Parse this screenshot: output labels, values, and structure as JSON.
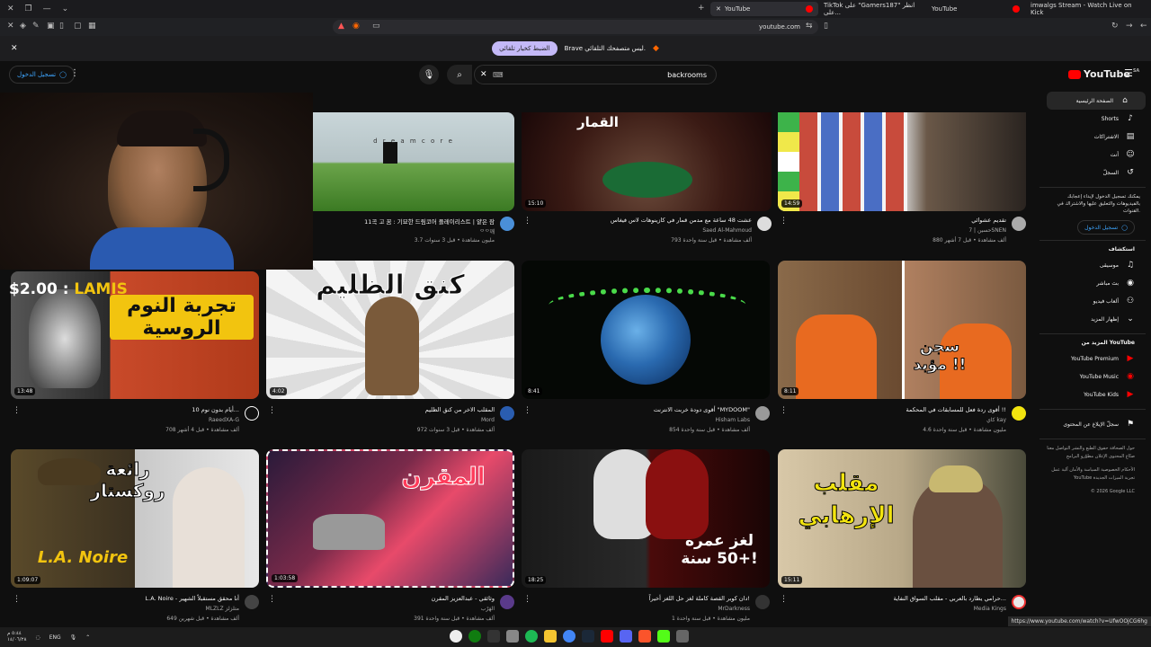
{
  "browser": {
    "tabs": [
      {
        "label": "YouTube"
      },
      {
        "label": "TikTok على \"Gamers187\" انظر على..."
      },
      {
        "label": "YouTube"
      },
      {
        "label": "imwalgs Stream - Watch Live on Kick"
      }
    ],
    "url": "youtube.com",
    "infobar_text": "Brave ليس متصفحك التلقائي.",
    "infobar_button": "الضبط كخيار تلقائي"
  },
  "youtube": {
    "search_value": "backrooms",
    "signin_label": "تسجيل الدخول",
    "logo_text": "YouTube",
    "logo_region": "SA"
  },
  "sidebar": {
    "items": [
      {
        "label": "الصفحة الرئيسية",
        "icon": "home-icon"
      },
      {
        "label": "Shorts",
        "icon": "shorts-icon"
      },
      {
        "label": "الاشتراكات",
        "icon": "subscriptions-icon"
      },
      {
        "label": "أنت",
        "icon": "you-icon"
      },
      {
        "label": "السجلّ",
        "icon": "history-icon"
      }
    ],
    "note": "يمكنك تسجيل الدخول لإبداء إعجابك بالفيديوهات والتعليق عليها والاشتراك في القنوات.",
    "signin_label": "تسجيل الدخول",
    "explore_heading": "استكشاف",
    "explore": [
      {
        "label": "موسيقى",
        "icon": "music-icon"
      },
      {
        "label": "بث مباشر",
        "icon": "live-icon"
      },
      {
        "label": "ألعاب فيديو",
        "icon": "gaming-icon"
      },
      {
        "label": "إظهار المزيد",
        "icon": "chevron-down-icon"
      }
    ],
    "more_heading": "المزيد من YouTube",
    "more": [
      {
        "label": "YouTube Premium"
      },
      {
        "label": "YouTube Music"
      },
      {
        "label": "YouTube Kids"
      }
    ],
    "report": "سجلّ الإبلاغ عن المحتوى",
    "footer1": "حول  الصحافة  حقوق الطبع والنشر  التواصل معنا  صنّاع المحتوى  الإعلان  مطوّرو البرامج",
    "footer2": "الأحكام  الخصوصية  السياسة والأمان  آلية عمل YouTube  تجربة الميزات الجديدة",
    "copyright": "© 2026 Google LLC"
  },
  "stream": {
    "donation_amount": "$2.00 : ",
    "donation_name": "LAMIS"
  },
  "videos": [
    {
      "title": "11곡 고 꿈 : 기묘한 드림코어 플레이리스트 | 얕은 잠",
      "channel": "ᄋᄋ깨",
      "views": "3.7 مليون مشاهدة • قبل 3 سنوات",
      "duration": "",
      "thumb_text": "d r e a m c o r e"
    },
    {
      "title": "عشت 48 ساعة مع مدمن قمار في كازينوهات لاس فيغاس",
      "channel": "Saed Al-Mahmoud",
      "views": "793 ألف مشاهدة • قبل سنة واحدة",
      "duration": "15:10",
      "thumb_text": "القمار"
    },
    {
      "title": "تقديم عشوائي",
      "channel": "حسين | 7SNEN",
      "views": "880 ألف مشاهدة • قبل 7 أشهر",
      "duration": "14:59",
      "thumb_text": ""
    },
    {
      "title": "10 أيام بدون نوم...",
      "channel": "RaeedXA-G",
      "views": "708 ألف مشاهدة • قبل 4 أشهر",
      "duration": "13:48",
      "thumb_text": "تجربة النوم الروسية"
    },
    {
      "title": "المقلب الاخر من كنق الظليم",
      "channel": "Mord",
      "views": "972 ألف مشاهدة • قبل 3 سنوات",
      "duration": "4:02",
      "thumb_text": "كنق الظليم"
    },
    {
      "title": "أقوى دودة خربت الانترنت \"MYDOOM\"",
      "channel": "Hisham Labs",
      "views": "854 ألف مشاهدة • قبل سنة واحدة",
      "duration": "8:41",
      "thumb_text": ""
    },
    {
      "title": "أقوى ردة فعل للمسابقات في المحكمة !!",
      "channel": "كاي kay",
      "views": "4.6 مليون مشاهدة • قبل سنة واحدة",
      "duration": "8:11",
      "thumb_text": "سجن مؤبد !!"
    },
    {
      "title": "L.A. Noire - أنا محقق مستقبلاً الشهير",
      "channel": "MLZLZ متلزلز",
      "views": "649 ألف مشاهدة • قبل شهرين",
      "duration": "1:09:07",
      "thumb_text": "رائعة روكستار"
    },
    {
      "title": "وثائقي - عبدالعزيز المقرن",
      "channel": "الهَرْب",
      "views": "391 ألف مشاهدة • قبل سنة واحدة",
      "duration": "1:03:58",
      "thumb_text": "المقرن"
    },
    {
      "title": "دان كوبر القصة كاملة لغز حل اللغز أخيراً!",
      "channel": "MrDarkness",
      "views": "1 مليون مشاهدة • قبل سنة واحدة",
      "duration": "18:25",
      "thumb_text": "لغز عمره +50 سنة!"
    },
    {
      "title": "حرامي يطارد بالعربي - مقلب السواق النفاية...",
      "channel": "Media Kings",
      "views": "",
      "duration": "15:11",
      "thumb_text": "مقلب الإرهابي"
    }
  ],
  "taskbar": {
    "time": "٥:٤٤ م",
    "date": "١٤/٠٦/٢٨",
    "lang": "ENG"
  },
  "status_url": "https://www.youtube.com/watch?v=UfwOOjCG6hg"
}
